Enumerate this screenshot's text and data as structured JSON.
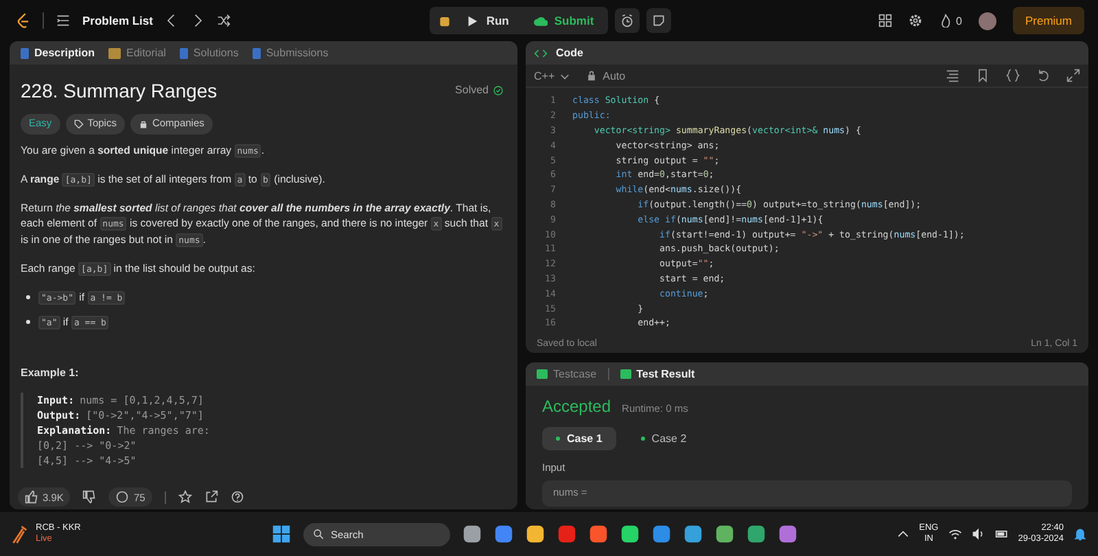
{
  "top_bar": {
    "title": "Problem List",
    "run": "Run",
    "submit": "Submit",
    "streak": "0",
    "premium": "Premium"
  },
  "left_panel": {
    "tabs": [
      {
        "label": "Description",
        "selected": true
      },
      {
        "label": "Editorial",
        "selected": false
      },
      {
        "label": "Solutions",
        "selected": false
      },
      {
        "label": "Submissions",
        "selected": false
      }
    ],
    "title": "228. Summary Ranges",
    "status": "Solved",
    "tags": [
      {
        "label": "Easy",
        "kind": "difficulty"
      },
      {
        "label": "Topics",
        "kind": "topics"
      },
      {
        "label": "Companies",
        "kind": "companies"
      }
    ],
    "paragraphs": [
      [
        {
          "kind": "text",
          "text": "You are given a **sorted unique** integer array "
        },
        {
          "kind": "code",
          "text": "nums"
        },
        {
          "kind": "text",
          "text": "."
        }
      ],
      [
        {
          "kind": "text",
          "text": "A **range** "
        },
        {
          "kind": "code",
          "text": "[a,b]"
        },
        {
          "kind": "text",
          "text": " is the set of all integers from "
        },
        {
          "kind": "code",
          "text": "a"
        },
        {
          "kind": "text",
          "text": " to "
        },
        {
          "kind": "code",
          "text": "b"
        },
        {
          "kind": "text",
          "text": " (inclusive)."
        }
      ],
      [
        {
          "kind": "text",
          "text": "Return "
        },
        {
          "kind": "em",
          "text": "the **smallest sorted** list of ranges that **cover all the numbers in the array exactly**"
        },
        {
          "kind": "text",
          "text": ". That is, each element of "
        },
        {
          "kind": "code",
          "text": "nums"
        },
        {
          "kind": "text",
          "text": " is covered by exactly one of the ranges, and there is no integer "
        },
        {
          "kind": "code",
          "text": "x"
        },
        {
          "kind": "text",
          "text": " such that "
        },
        {
          "kind": "code",
          "text": "x"
        },
        {
          "kind": "text",
          "text": " is in one of the ranges but not in "
        },
        {
          "kind": "code",
          "text": "nums"
        },
        {
          "kind": "text",
          "text": "."
        }
      ],
      [
        {
          "kind": "text",
          "text": "Each range "
        },
        {
          "kind": "code",
          "text": "[a,b]"
        },
        {
          "kind": "text",
          "text": " in the list should be output as:"
        }
      ]
    ],
    "bullets": [
      [
        {
          "kind": "code",
          "text": "\"a->b\""
        },
        {
          "kind": "text",
          "text": " if "
        },
        {
          "kind": "code",
          "text": "a != b"
        }
      ],
      [
        {
          "kind": "code",
          "text": "\"a\""
        },
        {
          "kind": "text",
          "text": " if "
        },
        {
          "kind": "code",
          "text": "a == b"
        }
      ]
    ],
    "example_title": "Example 1:",
    "example_lines": [
      {
        "label": "Input:",
        "value": "nums = [0,1,2,4,5,7]"
      },
      {
        "label": "Output:",
        "value": "[\"0->2\",\"4->5\",\"7\"]"
      },
      {
        "label": "Explanation:",
        "value": "The ranges are:"
      },
      {
        "value": "[0,2] --> \"0->2\""
      },
      {
        "value": "[4,5] --> \"4->5\""
      }
    ],
    "likes": "3.9K",
    "comments": "75"
  },
  "code_panel": {
    "title": "Code",
    "language": "C++",
    "mode": "Auto",
    "lines": [
      {
        "number": "1",
        "tokens": [
          {
            "kind": "kw",
            "text": "class "
          },
          {
            "kind": "type",
            "text": "Solution"
          },
          {
            "kind": "plain",
            "text": " {"
          }
        ]
      },
      {
        "number": "2",
        "tokens": [
          {
            "kind": "kw",
            "text": "public:"
          }
        ]
      },
      {
        "number": "3",
        "tokens": [
          {
            "kind": "type",
            "text": "    vector<string> "
          },
          {
            "kind": "fn",
            "text": "summaryRanges"
          },
          {
            "kind": "plain",
            "text": "("
          },
          {
            "kind": "type",
            "text": "vector<int>& "
          },
          {
            "kind": "var",
            "text": "nums"
          },
          {
            "kind": "plain",
            "text": ") {"
          }
        ]
      },
      {
        "number": "4",
        "tokens": [
          {
            "kind": "plain",
            "text": "        vector<string> ans;"
          }
        ]
      },
      {
        "number": "5",
        "tokens": [
          {
            "kind": "plain",
            "text": "        string output = "
          },
          {
            "kind": "str",
            "text": "\"\""
          },
          {
            "kind": "plain",
            "text": ";"
          }
        ]
      },
      {
        "number": "6",
        "tokens": [
          {
            "kind": "kw",
            "text": "        int"
          },
          {
            "kind": "plain",
            "text": " end="
          },
          {
            "kind": "num",
            "text": "0"
          },
          {
            "kind": "plain",
            "text": ",start="
          },
          {
            "kind": "num",
            "text": "0"
          },
          {
            "kind": "plain",
            "text": ";"
          }
        ]
      },
      {
        "number": "7",
        "tokens": [
          {
            "kind": "kw",
            "text": "        while"
          },
          {
            "kind": "plain",
            "text": "(end<"
          },
          {
            "kind": "var",
            "text": "nums"
          },
          {
            "kind": "plain",
            "text": ".size()){"
          }
        ]
      },
      {
        "number": "8",
        "tokens": [
          {
            "kind": "kw",
            "text": "            if"
          },
          {
            "kind": "plain",
            "text": "(output.length()=="
          },
          {
            "kind": "num",
            "text": "0"
          },
          {
            "kind": "plain",
            "text": ") output+=to_string("
          },
          {
            "kind": "var",
            "text": "nums"
          },
          {
            "kind": "plain",
            "text": "[end]);"
          }
        ]
      },
      {
        "number": "9",
        "tokens": [
          {
            "kind": "kw",
            "text": "            else if"
          },
          {
            "kind": "plain",
            "text": "("
          },
          {
            "kind": "var",
            "text": "nums"
          },
          {
            "kind": "plain",
            "text": "[end]!="
          },
          {
            "kind": "var",
            "text": "nums"
          },
          {
            "kind": "plain",
            "text": "[end-1]+1){"
          }
        ]
      },
      {
        "number": "10",
        "tokens": [
          {
            "kind": "kw",
            "text": "                if"
          },
          {
            "kind": "plain",
            "text": "(start!=end-1) output+= "
          },
          {
            "kind": "str",
            "text": "\"->\""
          },
          {
            "kind": "plain",
            "text": " + to_string("
          },
          {
            "kind": "var",
            "text": "nums"
          },
          {
            "kind": "plain",
            "text": "[end-1]);"
          }
        ]
      },
      {
        "number": "11",
        "tokens": [
          {
            "kind": "plain",
            "text": "                ans.push_back(output);"
          }
        ]
      },
      {
        "number": "12",
        "tokens": [
          {
            "kind": "plain",
            "text": "                output="
          },
          {
            "kind": "str",
            "text": "\"\""
          },
          {
            "kind": "plain",
            "text": ";"
          }
        ]
      },
      {
        "number": "13",
        "tokens": [
          {
            "kind": "plain",
            "text": "                start = end;"
          }
        ]
      },
      {
        "number": "14",
        "tokens": [
          {
            "kind": "kw",
            "text": "                continue"
          },
          {
            "kind": "plain",
            "text": ";"
          }
        ]
      },
      {
        "number": "15",
        "tokens": [
          {
            "kind": "plain",
            "text": "            }"
          }
        ]
      },
      {
        "number": "16",
        "tokens": [
          {
            "kind": "plain",
            "text": "            end++;"
          }
        ]
      }
    ],
    "saved": "Saved to local",
    "cursor": "Ln 1, Col 1"
  },
  "result_panel": {
    "tabs": [
      {
        "label": "Testcase",
        "selected": false
      },
      {
        "label": "Test Result",
        "selected": true
      }
    ],
    "verdict": "Accepted",
    "runtime": "Runtime: 0 ms",
    "cases": [
      {
        "label": "Case 1",
        "selected": true
      },
      {
        "label": "Case 2",
        "selected": false
      }
    ],
    "input_label": "Input",
    "input_value": "nums ="
  },
  "taskbar": {
    "widget_title": "RCB - KKR",
    "widget_status": "Live",
    "search": "Search",
    "language": "ENG",
    "region": "IN",
    "time": "22:40",
    "date": "29-03-2024"
  }
}
